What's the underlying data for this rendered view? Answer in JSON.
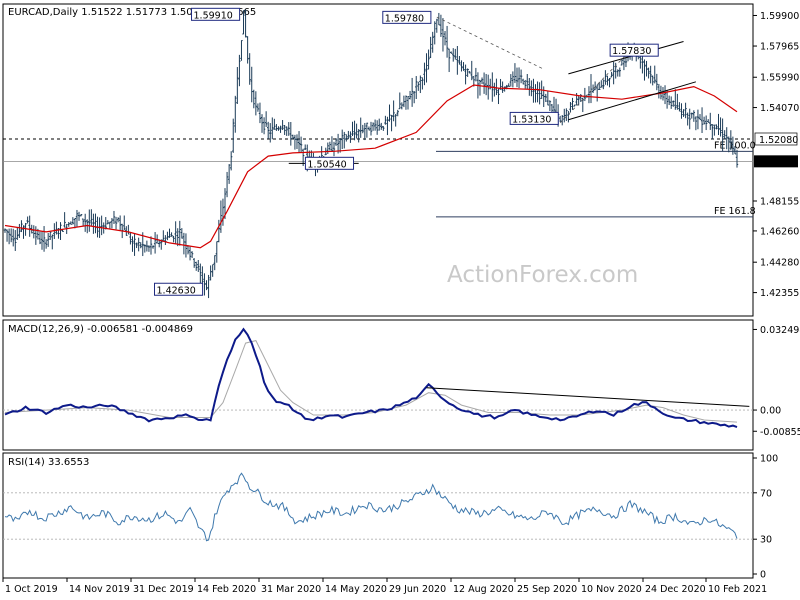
{
  "colors": {
    "candle": "#1b3b57",
    "ma": "#d40000",
    "macd": "#0d1a8a",
    "signal": "#a9a9a9",
    "rsi": "#3f79ad",
    "tag_border": "#1f2a80",
    "grid": "#000000",
    "watermark": "#c9c9c9"
  },
  "watermark": "ActionForex.com",
  "chart_data": [
    {
      "type": "candlestick",
      "header": "EURCAD,Daily  1.51522 1.51773 1.50656 1.50665",
      "ylim": [
        1.41,
        1.605
      ],
      "y_ticks": [
        "1.59900",
        "1.57965",
        "1.55990",
        "1.54070",
        "1.52080",
        "1.50665",
        "1.48155",
        "1.46260",
        "1.44280",
        "1.42355"
      ],
      "x_ticks": [
        "1 Oct 2019",
        "14 Nov 2019",
        "31 Dec 2019",
        "14 Feb 2020",
        "31 Mar 2020",
        "14 May 2020",
        "29 Jun 2020",
        "12 Aug 2020",
        "25 Sep 2020",
        "10 Nov 2020",
        "24 Dec 2020",
        "10 Feb 2021"
      ],
      "annotations": [
        "1.59910",
        "1.59780",
        "1.57830",
        "1.53130",
        "1.50540",
        "1.42630"
      ],
      "levels": [
        {
          "label": "1.52080",
          "value": 1.5208,
          "style": "dashed"
        },
        {
          "label": "1.50665",
          "value": 1.50665,
          "style": "current"
        }
      ],
      "fe_levels": [
        {
          "label": "FE 100.0",
          "value": 1.513
        },
        {
          "label": "FE 161.8",
          "value": 1.4715
        }
      ],
      "moving_average": [
        [
          0,
          1.466
        ],
        [
          20,
          1.462
        ],
        [
          40,
          1.466
        ],
        [
          60,
          1.462
        ],
        [
          80,
          1.455
        ],
        [
          95,
          1.452
        ],
        [
          100,
          1.456
        ],
        [
          108,
          1.475
        ],
        [
          118,
          1.5
        ],
        [
          128,
          1.51
        ],
        [
          140,
          1.512
        ],
        [
          160,
          1.513
        ],
        [
          180,
          1.515
        ],
        [
          200,
          1.525
        ],
        [
          215,
          1.545
        ],
        [
          228,
          1.555
        ],
        [
          240,
          1.553
        ],
        [
          260,
          1.552
        ],
        [
          280,
          1.548
        ],
        [
          300,
          1.546
        ],
        [
          320,
          1.55
        ],
        [
          335,
          1.554
        ],
        [
          345,
          1.548
        ],
        [
          356,
          1.538
        ]
      ],
      "price_path": [
        [
          0,
          1.463
        ],
        [
          5,
          1.458
        ],
        [
          10,
          1.468
        ],
        [
          18,
          1.455
        ],
        [
          25,
          1.462
        ],
        [
          35,
          1.472
        ],
        [
          45,
          1.465
        ],
        [
          55,
          1.47
        ],
        [
          62,
          1.455
        ],
        [
          70,
          1.452
        ],
        [
          78,
          1.458
        ],
        [
          85,
          1.462
        ],
        [
          90,
          1.448
        ],
        [
          94,
          1.438
        ],
        [
          98,
          1.4263
        ],
        [
          102,
          1.448
        ],
        [
          106,
          1.478
        ],
        [
          110,
          1.512
        ],
        [
          113,
          1.56
        ],
        [
          116,
          1.5991
        ],
        [
          119,
          1.558
        ],
        [
          122,
          1.54
        ],
        [
          128,
          1.525
        ],
        [
          135,
          1.53
        ],
        [
          142,
          1.518
        ],
        [
          150,
          1.5054
        ],
        [
          158,
          1.515
        ],
        [
          166,
          1.522
        ],
        [
          175,
          1.528
        ],
        [
          185,
          1.53
        ],
        [
          195,
          1.545
        ],
        [
          205,
          1.565
        ],
        [
          210,
          1.5978
        ],
        [
          216,
          1.575
        ],
        [
          222,
          1.566
        ],
        [
          230,
          1.558
        ],
        [
          240,
          1.552
        ],
        [
          250,
          1.56
        ],
        [
          258,
          1.552
        ],
        [
          265,
          1.543
        ],
        [
          270,
          1.5313
        ],
        [
          278,
          1.546
        ],
        [
          288,
          1.553
        ],
        [
          298,
          1.565
        ],
        [
          305,
          1.5783
        ],
        [
          310,
          1.57
        ],
        [
          320,
          1.548
        ],
        [
          327,
          1.54
        ],
        [
          335,
          1.535
        ],
        [
          345,
          1.53
        ],
        [
          352,
          1.52
        ],
        [
          356,
          1.50665
        ]
      ]
    },
    {
      "type": "line",
      "header": "MACD(12,26,9) -0.006581 -0.004869",
      "ylim": [
        -0.0153,
        0.0355
      ],
      "y_ticks": [
        "0.032498",
        "0.00",
        "-0.00855"
      ],
      "trendline": [
        [
          205,
          0.009
        ],
        [
          362,
          0.0015
        ]
      ],
      "macd": [
        [
          0,
          -0.002
        ],
        [
          10,
          0.001
        ],
        [
          20,
          -0.001
        ],
        [
          30,
          0.002
        ],
        [
          40,
          0.001
        ],
        [
          50,
          0.002
        ],
        [
          60,
          -0.001
        ],
        [
          70,
          -0.004
        ],
        [
          80,
          -0.003
        ],
        [
          90,
          -0.002
        ],
        [
          95,
          -0.004
        ],
        [
          100,
          -0.004
        ],
        [
          104,
          0.01
        ],
        [
          108,
          0.02
        ],
        [
          112,
          0.028
        ],
        [
          116,
          0.0325
        ],
        [
          119,
          0.03
        ],
        [
          123,
          0.02
        ],
        [
          127,
          0.009
        ],
        [
          132,
          0.003
        ],
        [
          138,
          0.002
        ],
        [
          145,
          -0.003
        ],
        [
          150,
          -0.004
        ],
        [
          157,
          -0.002
        ],
        [
          165,
          -0.003
        ],
        [
          175,
          -0.001
        ],
        [
          185,
          0.0
        ],
        [
          195,
          0.003
        ],
        [
          202,
          0.006
        ],
        [
          206,
          0.01
        ],
        [
          209,
          0.008
        ],
        [
          214,
          0.004
        ],
        [
          220,
          0.001
        ],
        [
          230,
          -0.002
        ],
        [
          240,
          -0.003
        ],
        [
          248,
          0.0
        ],
        [
          256,
          -0.002
        ],
        [
          264,
          -0.003
        ],
        [
          272,
          -0.004
        ],
        [
          280,
          -0.002
        ],
        [
          288,
          0.0
        ],
        [
          296,
          -0.002
        ],
        [
          305,
          0.002
        ],
        [
          312,
          0.003
        ],
        [
          318,
          0.0
        ],
        [
          324,
          -0.003
        ],
        [
          332,
          -0.004
        ],
        [
          340,
          -0.005
        ],
        [
          348,
          -0.006
        ],
        [
          356,
          -0.00658
        ]
      ],
      "signal": [
        [
          0,
          -0.001
        ],
        [
          20,
          0.0
        ],
        [
          40,
          0.001
        ],
        [
          60,
          0.0
        ],
        [
          80,
          -0.003
        ],
        [
          100,
          -0.003
        ],
        [
          106,
          0.003
        ],
        [
          112,
          0.016
        ],
        [
          117,
          0.027
        ],
        [
          122,
          0.028
        ],
        [
          128,
          0.018
        ],
        [
          134,
          0.008
        ],
        [
          140,
          0.003
        ],
        [
          150,
          -0.002
        ],
        [
          165,
          -0.002
        ],
        [
          180,
          -0.001
        ],
        [
          195,
          0.002
        ],
        [
          206,
          0.007
        ],
        [
          214,
          0.006
        ],
        [
          222,
          0.002
        ],
        [
          235,
          -0.001
        ],
        [
          250,
          -0.001
        ],
        [
          265,
          -0.002
        ],
        [
          280,
          -0.002
        ],
        [
          300,
          0.0
        ],
        [
          312,
          0.002
        ],
        [
          320,
          0.001
        ],
        [
          330,
          -0.002
        ],
        [
          340,
          -0.004
        ],
        [
          356,
          -0.00487
        ]
      ]
    },
    {
      "type": "line",
      "header": "RSI(14) 33.6553",
      "ylim": [
        0,
        100
      ],
      "y_ticks": [
        "100",
        "70",
        "30",
        "0"
      ],
      "levels": [
        70,
        30
      ],
      "rsi": [
        [
          0,
          50
        ],
        [
          6,
          45
        ],
        [
          12,
          55
        ],
        [
          18,
          48
        ],
        [
          25,
          52
        ],
        [
          32,
          58
        ],
        [
          40,
          48
        ],
        [
          48,
          53
        ],
        [
          55,
          45
        ],
        [
          62,
          50
        ],
        [
          70,
          47
        ],
        [
          78,
          52
        ],
        [
          85,
          44
        ],
        [
          90,
          55
        ],
        [
          95,
          38
        ],
        [
          99,
          30
        ],
        [
          103,
          55
        ],
        [
          108,
          72
        ],
        [
          112,
          80
        ],
        [
          116,
          85
        ],
        [
          119,
          76
        ],
        [
          123,
          70
        ],
        [
          128,
          62
        ],
        [
          135,
          58
        ],
        [
          142,
          45
        ],
        [
          150,
          50
        ],
        [
          158,
          55
        ],
        [
          166,
          52
        ],
        [
          175,
          60
        ],
        [
          185,
          55
        ],
        [
          195,
          62
        ],
        [
          203,
          70
        ],
        [
          208,
          75
        ],
        [
          213,
          66
        ],
        [
          220,
          56
        ],
        [
          230,
          52
        ],
        [
          240,
          55
        ],
        [
          248,
          50
        ],
        [
          256,
          47
        ],
        [
          264,
          54
        ],
        [
          272,
          44
        ],
        [
          280,
          52
        ],
        [
          288,
          56
        ],
        [
          296,
          50
        ],
        [
          304,
          60
        ],
        [
          310,
          55
        ],
        [
          318,
          45
        ],
        [
          326,
          50
        ],
        [
          334,
          42
        ],
        [
          342,
          48
        ],
        [
          350,
          40
        ],
        [
          356,
          33.66
        ]
      ]
    }
  ]
}
